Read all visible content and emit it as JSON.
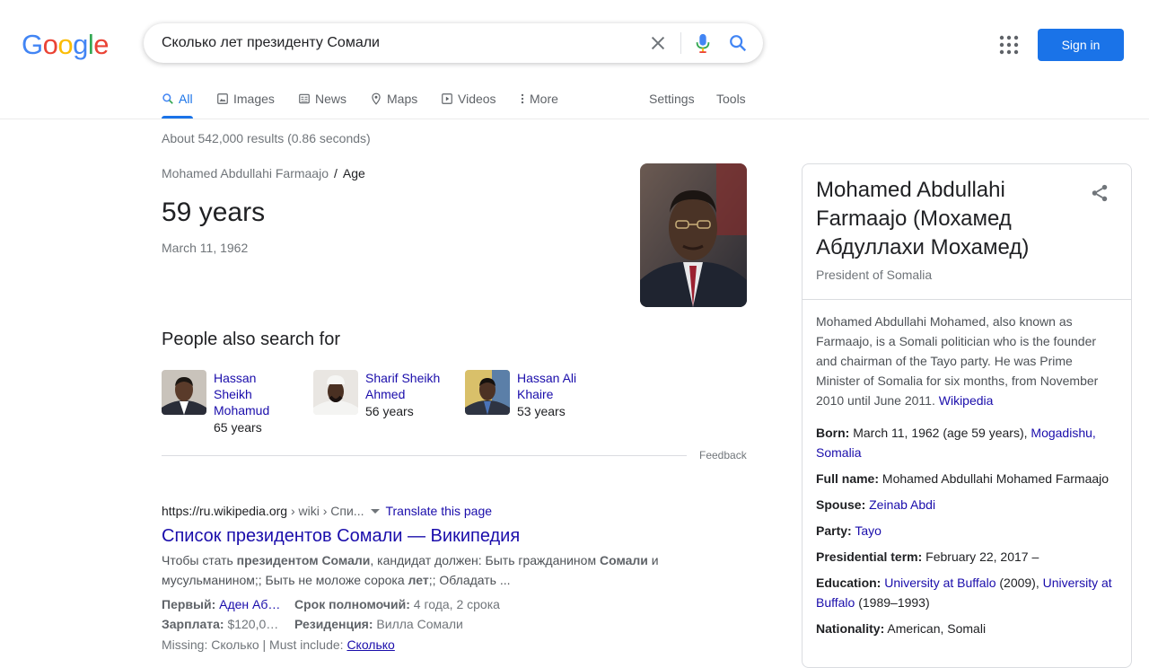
{
  "brand": {
    "logo_letters": [
      "G",
      "o",
      "o",
      "g",
      "l",
      "e"
    ],
    "logo_colors": [
      "#4285f4",
      "#ea4335",
      "#fbbc05",
      "#4285f4",
      "#34a853",
      "#ea4335"
    ]
  },
  "search": {
    "query": "Сколько лет президенту Сомали"
  },
  "header": {
    "signin_label": "Sign in"
  },
  "tabs": [
    {
      "label": "All",
      "icon": "search-icon"
    },
    {
      "label": "Images",
      "icon": "image-icon"
    },
    {
      "label": "News",
      "icon": "news-icon"
    },
    {
      "label": "Maps",
      "icon": "map-pin-icon"
    },
    {
      "label": "Videos",
      "icon": "video-icon"
    },
    {
      "label": "More",
      "icon": "more-vert-icon"
    },
    {
      "label": "Settings"
    },
    {
      "label": "Tools"
    }
  ],
  "stats": "About 542,000 results (0.86 seconds)",
  "answer": {
    "breadcrumb_entity": "Mohamed Abdullahi Farmaajo",
    "breadcrumb_sep": "/",
    "breadcrumb_attr": "Age",
    "value": "59 years",
    "date": "March 11, 1962"
  },
  "people_also": {
    "title": "People also search for",
    "items": [
      {
        "name": "Hassan Sheikh Mohamud",
        "age": "65 years"
      },
      {
        "name": "Sharif Sheikh Ahmed",
        "age": "56 years"
      },
      {
        "name": "Hassan Ali Khaire",
        "age": "53 years"
      }
    ],
    "feedback": "Feedback"
  },
  "result": {
    "url_host": "https://ru.wikipedia.org",
    "url_path": " › wiki › Спи...",
    "translate": "Translate this page",
    "title": "Список президентов Сомали — Википедия",
    "snippet_1a": "Чтобы стать ",
    "snippet_1b": "президентом Сомали",
    "snippet_1c": ", кандидат должен: Быть гражданином ",
    "snippet_1d": "Сомали",
    "snippet_1e": " и",
    "snippet_2a": "мусульманином;; Быть не моложе сорока ",
    "snippet_2b": "лет",
    "snippet_2c": ";; Обладать ...",
    "fact1_label": "Первый:",
    "fact1_value": "Аден Аб…",
    "fact2_label": "Срок полномочий:",
    "fact2_value": "4 года, 2 срока",
    "fact3_label": "Зарплата:",
    "fact3_value": "$120,0…",
    "fact4_label": "Резиденция:",
    "fact4_value": "Вилла Сомали",
    "missing_label": "Missing: Сколько | Must include: ",
    "missing_link": "Сколько"
  },
  "knowledge_panel": {
    "title": "Mohamed Abdullahi Farmaajo (Мохамед Абдуллахи Мохамед)",
    "subtitle": "President of Somalia",
    "description": "Mohamed Abdullahi Mohamed, also known as Farmaajo, is a Somali politician who is the founder and chairman of the Tayo party. He was Prime Minister of Somalia for six months, from November 2010 until June 2011. ",
    "description_link": "Wikipedia",
    "born_label": "Born:",
    "born_value": " March 11, 1962 (age 59 years), ",
    "born_link": "Mogadishu, Somalia",
    "fullname_label": "Full name:",
    "fullname_value": " Mohamed Abdullahi Mohamed Farmaajo",
    "spouse_label": "Spouse:",
    "spouse_link": "Zeinab Abdi",
    "party_label": "Party:",
    "party_link": "Tayo",
    "term_label": "Presidential term:",
    "term_value": " February 22, 2017 –",
    "edu_label": "Education:",
    "edu_link1": "University at Buffalo",
    "edu_mid": " (2009), ",
    "edu_link2": "University at Buffalo",
    "edu_end": " (1989–1993)",
    "nationality_label": "Nationality:",
    "nationality_value": " American, Somali"
  }
}
